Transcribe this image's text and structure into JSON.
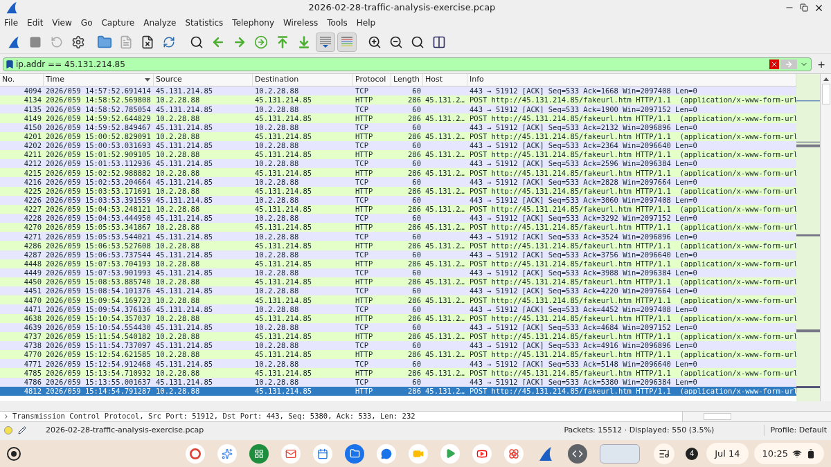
{
  "window": {
    "title": "2026-02-28-traffic-analysis-exercise.pcap"
  },
  "menu": [
    "File",
    "Edit",
    "View",
    "Go",
    "Capture",
    "Analyze",
    "Statistics",
    "Telephony",
    "Wireless",
    "Tools",
    "Help"
  ],
  "filter": {
    "value": "ip.addr == 45.131.214.85",
    "plus": "+"
  },
  "columns": [
    {
      "label": "No.",
      "sorted": false
    },
    {
      "label": "Time",
      "sorted": true
    },
    {
      "label": "Source",
      "sorted": false
    },
    {
      "label": "Destination",
      "sorted": false
    },
    {
      "label": "Protocol",
      "sorted": false
    },
    {
      "label": "Length",
      "sorted": false
    },
    {
      "label": "Host",
      "sorted": false
    },
    {
      "label": "Info",
      "sorted": false
    }
  ],
  "packets": [
    {
      "no": "4094",
      "time": "2026/059 14:57:52.691414",
      "source": "45.131.214.85",
      "destination": "10.2.28.88",
      "protocol": "TCP",
      "kind": "tcp",
      "length": "60",
      "info": "443 → 51912 [ACK] Seq=533 Ack=1668 Win=2097408 Len=0",
      "selected": false
    },
    {
      "no": "4134",
      "time": "2026/059 14:58:52.569808",
      "source": "10.2.28.88",
      "destination": "45.131.214.85",
      "protocol": "HTTP",
      "kind": "http",
      "length": "286",
      "host": "45.131.2…",
      "info": "POST http://45.131.214.85/fakeurl.htm HTTP/1.1  (application/x-www-form-url",
      "selected": false
    },
    {
      "no": "4135",
      "time": "2026/059 14:58:52.785054",
      "source": "45.131.214.85",
      "destination": "10.2.28.88",
      "protocol": "TCP",
      "kind": "tcp",
      "length": "60",
      "info": "443 → 51912 [ACK] Seq=533 Ack=1900 Win=2097152 Len=0",
      "selected": false
    },
    {
      "no": "4149",
      "time": "2026/059 14:59:52.644829",
      "source": "10.2.28.88",
      "destination": "45.131.214.85",
      "protocol": "HTTP",
      "kind": "http",
      "length": "286",
      "host": "45.131.2…",
      "info": "POST http://45.131.214.85/fakeurl.htm HTTP/1.1  (application/x-www-form-url",
      "selected": false
    },
    {
      "no": "4150",
      "time": "2026/059 14:59:52.849467",
      "source": "45.131.214.85",
      "destination": "10.2.28.88",
      "protocol": "TCP",
      "kind": "tcp",
      "length": "60",
      "info": "443 → 51912 [ACK] Seq=533 Ack=2132 Win=2096896 Len=0",
      "selected": false
    },
    {
      "no": "4201",
      "time": "2026/059 15:00:52.829091",
      "source": "10.2.28.88",
      "destination": "45.131.214.85",
      "protocol": "HTTP",
      "kind": "http",
      "length": "286",
      "host": "45.131.2…",
      "info": "POST http://45.131.214.85/fakeurl.htm HTTP/1.1  (application/x-www-form-url",
      "selected": false
    },
    {
      "no": "4202",
      "time": "2026/059 15:00:53.031693",
      "source": "45.131.214.85",
      "destination": "10.2.28.88",
      "protocol": "TCP",
      "kind": "tcp",
      "length": "60",
      "info": "443 → 51912 [ACK] Seq=533 Ack=2364 Win=2096640 Len=0",
      "selected": false
    },
    {
      "no": "4211",
      "time": "2026/059 15:01:52.909105",
      "source": "10.2.28.88",
      "destination": "45.131.214.85",
      "protocol": "HTTP",
      "kind": "http",
      "length": "286",
      "host": "45.131.2…",
      "info": "POST http://45.131.214.85/fakeurl.htm HTTP/1.1  (application/x-www-form-url",
      "selected": false
    },
    {
      "no": "4212",
      "time": "2026/059 15:01:53.112936",
      "source": "45.131.214.85",
      "destination": "10.2.28.88",
      "protocol": "TCP",
      "kind": "tcp",
      "length": "60",
      "info": "443 → 51912 [ACK] Seq=533 Ack=2596 Win=2096384 Len=0",
      "selected": false
    },
    {
      "no": "4215",
      "time": "2026/059 15:02:52.988882",
      "source": "10.2.28.88",
      "destination": "45.131.214.85",
      "protocol": "HTTP",
      "kind": "http",
      "length": "286",
      "host": "45.131.2…",
      "info": "POST http://45.131.214.85/fakeurl.htm HTTP/1.1  (application/x-www-form-url",
      "selected": false
    },
    {
      "no": "4216",
      "time": "2026/059 15:02:53.204664",
      "source": "45.131.214.85",
      "destination": "10.2.28.88",
      "protocol": "TCP",
      "kind": "tcp",
      "length": "60",
      "info": "443 → 51912 [ACK] Seq=533 Ack=2828 Win=2097664 Len=0",
      "selected": false
    },
    {
      "no": "4225",
      "time": "2026/059 15:03:53.171691",
      "source": "10.2.28.88",
      "destination": "45.131.214.85",
      "protocol": "HTTP",
      "kind": "http",
      "length": "286",
      "host": "45.131.2…",
      "info": "POST http://45.131.214.85/fakeurl.htm HTTP/1.1  (application/x-www-form-url",
      "selected": false
    },
    {
      "no": "4226",
      "time": "2026/059 15:03:53.391559",
      "source": "45.131.214.85",
      "destination": "10.2.28.88",
      "protocol": "TCP",
      "kind": "tcp",
      "length": "60",
      "info": "443 → 51912 [ACK] Seq=533 Ack=3060 Win=2097408 Len=0",
      "selected": false
    },
    {
      "no": "4227",
      "time": "2026/059 15:04:53.248121",
      "source": "10.2.28.88",
      "destination": "45.131.214.85",
      "protocol": "HTTP",
      "kind": "http",
      "length": "286",
      "host": "45.131.2…",
      "info": "POST http://45.131.214.85/fakeurl.htm HTTP/1.1  (application/x-www-form-url",
      "selected": false
    },
    {
      "no": "4228",
      "time": "2026/059 15:04:53.444950",
      "source": "45.131.214.85",
      "destination": "10.2.28.88",
      "protocol": "TCP",
      "kind": "tcp",
      "length": "60",
      "info": "443 → 51912 [ACK] Seq=533 Ack=3292 Win=2097152 Len=0",
      "selected": false
    },
    {
      "no": "4270",
      "time": "2026/059 15:05:53.341867",
      "source": "10.2.28.88",
      "destination": "45.131.214.85",
      "protocol": "HTTP",
      "kind": "http",
      "length": "286",
      "host": "45.131.2…",
      "info": "POST http://45.131.214.85/fakeurl.htm HTTP/1.1  (application/x-www-form-url",
      "selected": false
    },
    {
      "no": "4271",
      "time": "2026/059 15:05:53.544021",
      "source": "45.131.214.85",
      "destination": "10.2.28.88",
      "protocol": "TCP",
      "kind": "tcp",
      "length": "60",
      "info": "443 → 51912 [ACK] Seq=533 Ack=3524 Win=2096896 Len=0",
      "selected": false
    },
    {
      "no": "4286",
      "time": "2026/059 15:06:53.527608",
      "source": "10.2.28.88",
      "destination": "45.131.214.85",
      "protocol": "HTTP",
      "kind": "http",
      "length": "286",
      "host": "45.131.2…",
      "info": "POST http://45.131.214.85/fakeurl.htm HTTP/1.1  (application/x-www-form-url",
      "selected": false
    },
    {
      "no": "4287",
      "time": "2026/059 15:06:53.737544",
      "source": "45.131.214.85",
      "destination": "10.2.28.88",
      "protocol": "TCP",
      "kind": "tcp",
      "length": "60",
      "info": "443 → 51912 [ACK] Seq=533 Ack=3756 Win=2096640 Len=0",
      "selected": false
    },
    {
      "no": "4448",
      "time": "2026/059 15:07:53.704193",
      "source": "10.2.28.88",
      "destination": "45.131.214.85",
      "protocol": "HTTP",
      "kind": "http",
      "length": "286",
      "host": "45.131.2…",
      "info": "POST http://45.131.214.85/fakeurl.htm HTTP/1.1  (application/x-www-form-url",
      "selected": false
    },
    {
      "no": "4449",
      "time": "2026/059 15:07:53.901993",
      "source": "45.131.214.85",
      "destination": "10.2.28.88",
      "protocol": "TCP",
      "kind": "tcp",
      "length": "60",
      "info": "443 → 51912 [ACK] Seq=533 Ack=3988 Win=2096384 Len=0",
      "selected": false
    },
    {
      "no": "4450",
      "time": "2026/059 15:08:53.885740",
      "source": "10.2.28.88",
      "destination": "45.131.214.85",
      "protocol": "HTTP",
      "kind": "http",
      "length": "286",
      "host": "45.131.2…",
      "info": "POST http://45.131.214.85/fakeurl.htm HTTP/1.1  (application/x-www-form-url",
      "selected": false
    },
    {
      "no": "4451",
      "time": "2026/059 15:08:54.101376",
      "source": "45.131.214.85",
      "destination": "10.2.28.88",
      "protocol": "TCP",
      "kind": "tcp",
      "length": "60",
      "info": "443 → 51912 [ACK] Seq=533 Ack=4220 Win=2097664 Len=0",
      "selected": false
    },
    {
      "no": "4470",
      "time": "2026/059 15:09:54.169723",
      "source": "10.2.28.88",
      "destination": "45.131.214.85",
      "protocol": "HTTP",
      "kind": "http",
      "length": "286",
      "host": "45.131.2…",
      "info": "POST http://45.131.214.85/fakeurl.htm HTTP/1.1  (application/x-www-form-url",
      "selected": false
    },
    {
      "no": "4471",
      "time": "2026/059 15:09:54.376136",
      "source": "45.131.214.85",
      "destination": "10.2.28.88",
      "protocol": "TCP",
      "kind": "tcp",
      "length": "60",
      "info": "443 → 51912 [ACK] Seq=533 Ack=4452 Win=2097408 Len=0",
      "selected": false
    },
    {
      "no": "4638",
      "time": "2026/059 15:10:54.357037",
      "source": "10.2.28.88",
      "destination": "45.131.214.85",
      "protocol": "HTTP",
      "kind": "http",
      "length": "286",
      "host": "45.131.2…",
      "info": "POST http://45.131.214.85/fakeurl.htm HTTP/1.1  (application/x-www-form-url",
      "selected": false
    },
    {
      "no": "4639",
      "time": "2026/059 15:10:54.554430",
      "source": "45.131.214.85",
      "destination": "10.2.28.88",
      "protocol": "TCP",
      "kind": "tcp",
      "length": "60",
      "info": "443 → 51912 [ACK] Seq=533 Ack=4684 Win=2097152 Len=0",
      "selected": false
    },
    {
      "no": "4737",
      "time": "2026/059 15:11:54.540182",
      "source": "10.2.28.88",
      "destination": "45.131.214.85",
      "protocol": "HTTP",
      "kind": "http",
      "length": "286",
      "host": "45.131.2…",
      "info": "POST http://45.131.214.85/fakeurl.htm HTTP/1.1  (application/x-www-form-url",
      "selected": false
    },
    {
      "no": "4738",
      "time": "2026/059 15:11:54.737097",
      "source": "45.131.214.85",
      "destination": "10.2.28.88",
      "protocol": "TCP",
      "kind": "tcp",
      "length": "60",
      "info": "443 → 51912 [ACK] Seq=533 Ack=4916 Win=2096896 Len=0",
      "selected": false
    },
    {
      "no": "4770",
      "time": "2026/059 15:12:54.621585",
      "source": "10.2.28.88",
      "destination": "45.131.214.85",
      "protocol": "HTTP",
      "kind": "http",
      "length": "286",
      "host": "45.131.2…",
      "info": "POST http://45.131.214.85/fakeurl.htm HTTP/1.1  (application/x-www-form-url",
      "selected": false
    },
    {
      "no": "4771",
      "time": "2026/059 15:12:54.912468",
      "source": "45.131.214.85",
      "destination": "10.2.28.88",
      "protocol": "TCP",
      "kind": "tcp",
      "length": "60",
      "info": "443 → 51912 [ACK] Seq=533 Ack=5148 Win=2096640 Len=0",
      "selected": false
    },
    {
      "no": "4785",
      "time": "2026/059 15:13:54.710932",
      "source": "10.2.28.88",
      "destination": "45.131.214.85",
      "protocol": "HTTP",
      "kind": "http",
      "length": "286",
      "host": "45.131.2…",
      "info": "POST http://45.131.214.85/fakeurl.htm HTTP/1.1  (application/x-www-form-url",
      "selected": false
    },
    {
      "no": "4786",
      "time": "2026/059 15:13:55.001637",
      "source": "45.131.214.85",
      "destination": "10.2.28.88",
      "protocol": "TCP",
      "kind": "tcp",
      "length": "60",
      "info": "443 → 51912 [ACK] Seq=533 Ack=5380 Win=2096384 Len=0",
      "selected": false
    },
    {
      "no": "4812",
      "time": "2026/059 15:14:54.791287",
      "source": "10.2.28.88",
      "destination": "45.131.214.85",
      "protocol": "HTTP",
      "length": "286",
      "host": "45.131.2…",
      "info": "POST http://45.131.214.85/fakeurl.htm HTTP/1.1  (application/x-www-form-url",
      "selected": true
    }
  ],
  "details": [
    {
      "text": "Transmission Control Protocol, Src Port: 51912, Dst Port: 443, Seq: 5380, Ack: 533, Len: 232",
      "expanded": false
    }
  ],
  "status_bar": {
    "file": "2026-02-28-traffic-analysis-exercise.pcap",
    "packets": "Packets: 15512 · Displayed: 550 (3.5%)",
    "profile": "Profile: Default"
  },
  "taskbar": {
    "notifications": "4",
    "date": "Jul 14",
    "time": "10:25"
  }
}
